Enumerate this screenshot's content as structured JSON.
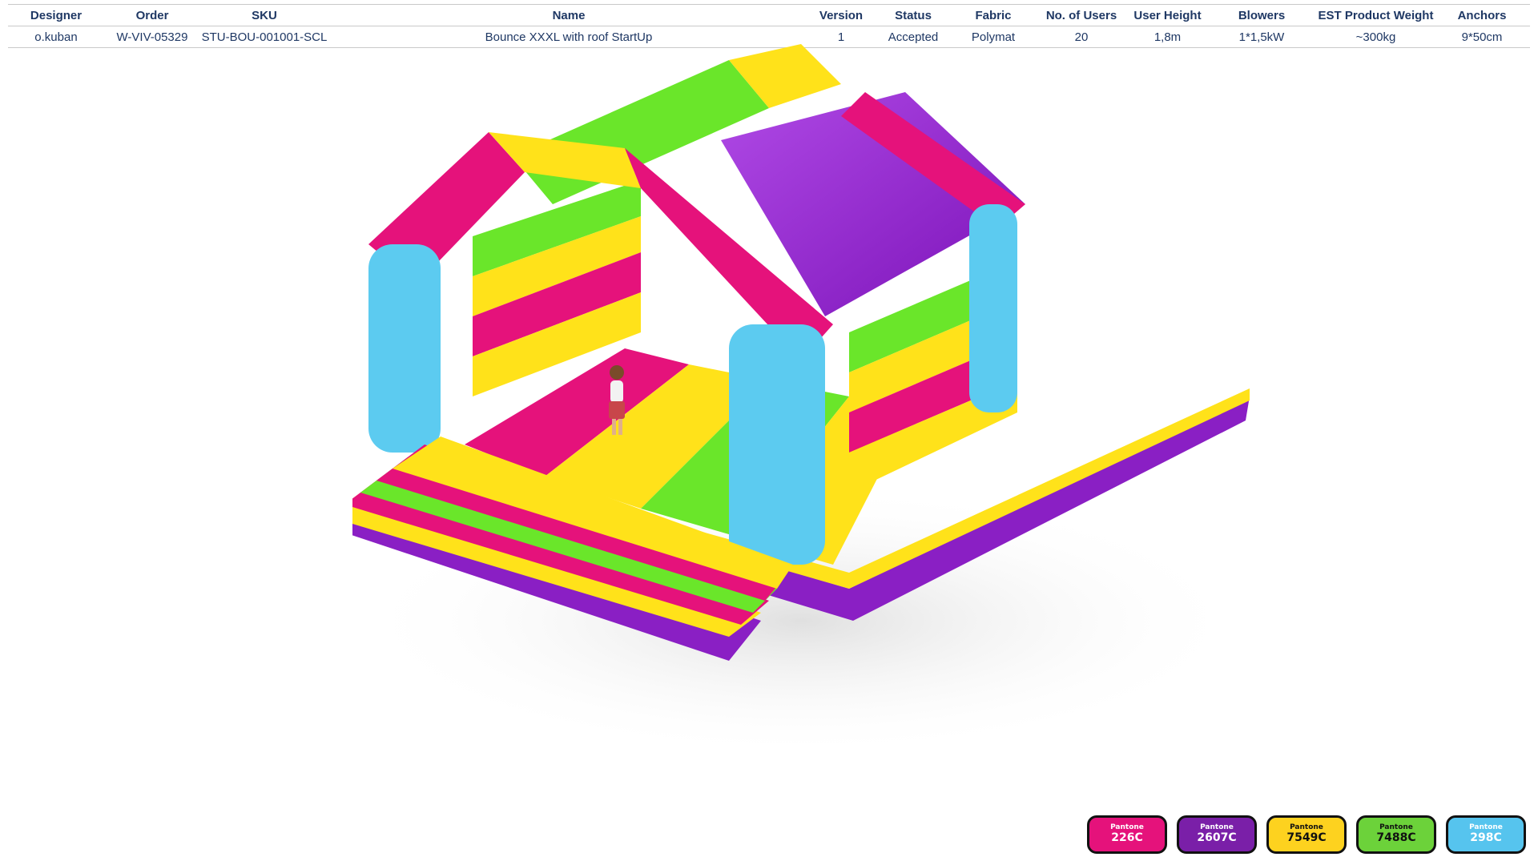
{
  "spec": {
    "headers": {
      "designer": "Designer",
      "order": "Order",
      "sku": "SKU",
      "name": "Name",
      "version": "Version",
      "status": "Status",
      "fabric": "Fabric",
      "users": "No. of Users",
      "height": "User  Height",
      "blowers": "Blowers",
      "weight": "EST Product Weight",
      "anchors": "Anchors"
    },
    "row": {
      "designer": "o.kuban",
      "order": "W-VIV-05329",
      "sku": "STU-BOU-001001-SCL",
      "name": "Bounce XXXL with roof StartUp",
      "version": "1",
      "status": "Accepted",
      "fabric": "Polymat",
      "users": "20",
      "height": "1,8m",
      "blowers": "1*1,5kW",
      "weight": "~300kg",
      "anchors": "9*50cm"
    }
  },
  "colors": {
    "pink": "#e5127b",
    "purple": "#8a1fc4",
    "yellow": "#ffe21a",
    "green": "#6ae62a",
    "blue": "#5ccbf0"
  },
  "swatches": [
    {
      "brand": "Pantone",
      "code": "226C",
      "color": "#e5127b",
      "text_color": "#ffffff"
    },
    {
      "brand": "Pantone",
      "code": "2607C",
      "color": "#7a1fa8",
      "text_color": "#ffffff"
    },
    {
      "brand": "Pantone",
      "code": "7549C",
      "color": "#fdd21f",
      "text_color": "#111111"
    },
    {
      "brand": "Pantone",
      "code": "7488C",
      "color": "#6cd23a",
      "text_color": "#111111"
    },
    {
      "brand": "Pantone",
      "code": "298C",
      "color": "#56c4ee",
      "text_color": "#ffffff"
    }
  ]
}
